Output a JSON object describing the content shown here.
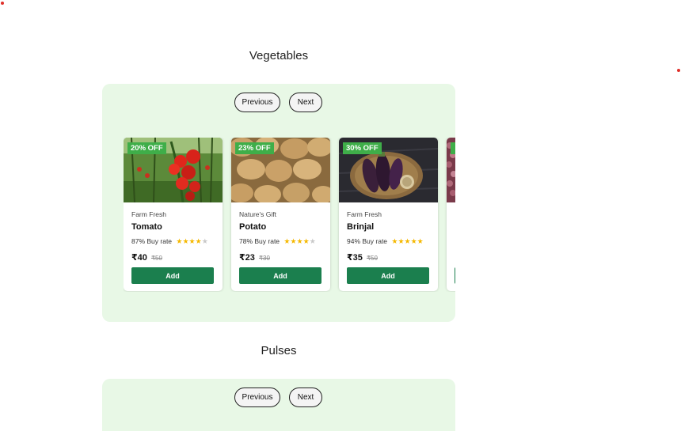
{
  "sections": [
    {
      "title": "Vegetables",
      "prev_label": "Previous",
      "next_label": "Next",
      "products": [
        {
          "discount": "20% OFF",
          "brand": "Farm Fresh",
          "name": "Tomato",
          "buy_rate": "87% Buy rate",
          "stars": 4,
          "price": "₹40",
          "mrp": "₹50",
          "add_label": "Add",
          "image": "tomato-image"
        },
        {
          "discount": "23% OFF",
          "brand": "Nature's Gift",
          "name": "Potato",
          "buy_rate": "78% Buy rate",
          "stars": 4,
          "price": "₹23",
          "mrp": "₹30",
          "add_label": "Add",
          "image": "potato-image"
        },
        {
          "discount": "30% OFF",
          "brand": "Farm Fresh",
          "name": "Brinjal",
          "buy_rate": "94% Buy rate",
          "stars": 5,
          "price": "₹35",
          "mrp": "₹50",
          "add_label": "Add",
          "image": "brinjal-image"
        }
      ]
    },
    {
      "title": "Pulses",
      "prev_label": "Previous",
      "next_label": "Next"
    }
  ],
  "colors": {
    "panel_bg": "#e8f8e6",
    "badge_bg": "#3fae49",
    "add_button_bg": "#1b7f4e",
    "star": "#f5b800",
    "marker_dot": "#e0302a"
  }
}
